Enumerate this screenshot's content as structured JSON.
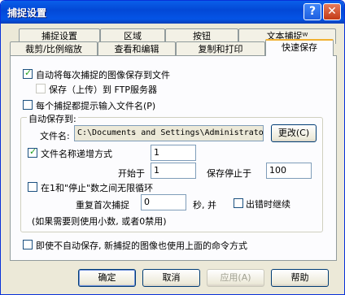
{
  "window": {
    "title": "捕捉设置",
    "help_glyph": "?",
    "close_glyph": "✕"
  },
  "tabs_row1": [
    "捕捉设置",
    "区域",
    "按钮",
    "文本捕捉ᵂ"
  ],
  "tabs_row2": [
    "裁剪/比例缩放",
    "查看和编辑",
    "复制和打印",
    "快速保存"
  ],
  "quicksave": {
    "autosave_label": "自动将每次捕捉的图像保存到文件",
    "ftp_label": "保存（上传）到 FTP服务器",
    "prompt_label": "每个捕捉都提示输入文件名(P)",
    "group_label": "自动保存到:",
    "filename_label": "文件名:",
    "filename_value": "C:\\Documents and Settings\\Administrato",
    "change_button": "更改(C)",
    "increment_label": "文件名称递增方式",
    "increment_value": "1",
    "start_label": "开始于",
    "start_value": "1",
    "stop_label": "保存停止于",
    "stop_value": "100",
    "loop_label": "在1和\"停止\"数之间无限循环",
    "repeat_label": "重复首次捕捉",
    "repeat_value": "0",
    "seconds_label": "秒, 并",
    "continue_label": "出错时继续",
    "note_label": "(如果需要则使用小数, 或者0禁用)",
    "command_label": "即使不自动保存, 新捕捉的图像也使用上面的命令方式"
  },
  "buttons": {
    "ok": "确定",
    "cancel": "取消",
    "apply": "应用(A)",
    "help": "帮助"
  }
}
